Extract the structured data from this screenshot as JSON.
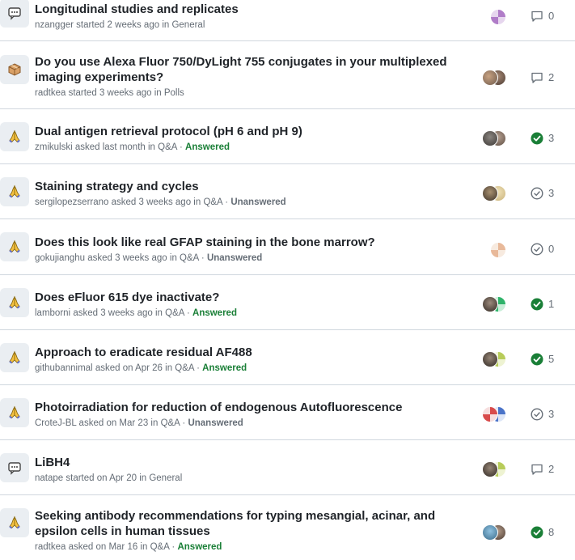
{
  "colors": {
    "answered": "#1a7f37",
    "muted": "#656d76",
    "border": "#d0d7de",
    "category_bg": "#eaeef2"
  },
  "discussions": [
    {
      "category_icon": "speech-bubble-icon",
      "title": "Longitudinal studies and replicates",
      "author": "nzangger",
      "verb": "started",
      "time": "2 weeks ago",
      "category": "General",
      "status": "",
      "status_icon": "comment-icon",
      "count": "0"
    },
    {
      "category_icon": "package-box-icon",
      "title": "Do you use Alexa Fluor 750/DyLight 755 conjugates in your multiplexed imaging experiments?",
      "author": "radtkea",
      "verb": "started",
      "time": "3 weeks ago",
      "category": "Polls",
      "status": "",
      "status_icon": "comment-icon",
      "count": "2"
    },
    {
      "category_icon": "praying-hands-icon",
      "title": "Dual antigen retrieval protocol (pH 6 and pH 9)",
      "author": "zmikulski",
      "verb": "asked",
      "time": "last month",
      "category": "Q&A",
      "status": "Answered",
      "status_icon": "check-filled-icon",
      "count": "3"
    },
    {
      "category_icon": "praying-hands-icon",
      "title": "Staining strategy and cycles",
      "author": "sergilopezserrano",
      "verb": "asked",
      "time": "3 weeks ago",
      "category": "Q&A",
      "status": "Unanswered",
      "status_icon": "check-outline-icon",
      "count": "3"
    },
    {
      "category_icon": "praying-hands-icon",
      "title": "Does this look like real GFAP staining in the bone marrow?",
      "author": "gokujianghu",
      "verb": "asked",
      "time": "3 weeks ago",
      "category": "Q&A",
      "status": "Unanswered",
      "status_icon": "check-outline-icon",
      "count": "0"
    },
    {
      "category_icon": "praying-hands-icon",
      "title": "Does eFluor 615 dye inactivate?",
      "author": "lamborni",
      "verb": "asked",
      "time": "3 weeks ago",
      "category": "Q&A",
      "status": "Answered",
      "status_icon": "check-filled-icon",
      "count": "1"
    },
    {
      "category_icon": "praying-hands-icon",
      "title": "Approach to eradicate residual AF488",
      "author": "githubannimal",
      "verb": "asked",
      "time": "on Apr 26",
      "category": "Q&A",
      "status": "Answered",
      "status_icon": "check-filled-icon",
      "count": "5"
    },
    {
      "category_icon": "praying-hands-icon",
      "title": "Photoirradiation for reduction of endogenous Autofluorescence",
      "author": "CroteJ-BL",
      "verb": "asked",
      "time": "on Mar 23",
      "category": "Q&A",
      "status": "Unanswered",
      "status_icon": "check-outline-icon",
      "count": "3"
    },
    {
      "category_icon": "speech-bubble-icon",
      "title": "LiBH4",
      "author": "natape",
      "verb": "started",
      "time": "on Apr 20",
      "category": "General",
      "status": "",
      "status_icon": "comment-icon",
      "count": "2"
    },
    {
      "category_icon": "praying-hands-icon",
      "title": "Seeking antibody recommendations for typing mesangial, acinar, and epsilon cells in human tissues",
      "author": "radtkea",
      "verb": "asked",
      "time": "on Mar 16",
      "category": "Q&A",
      "status": "Answered",
      "status_icon": "check-filled-icon",
      "count": "8"
    }
  ]
}
